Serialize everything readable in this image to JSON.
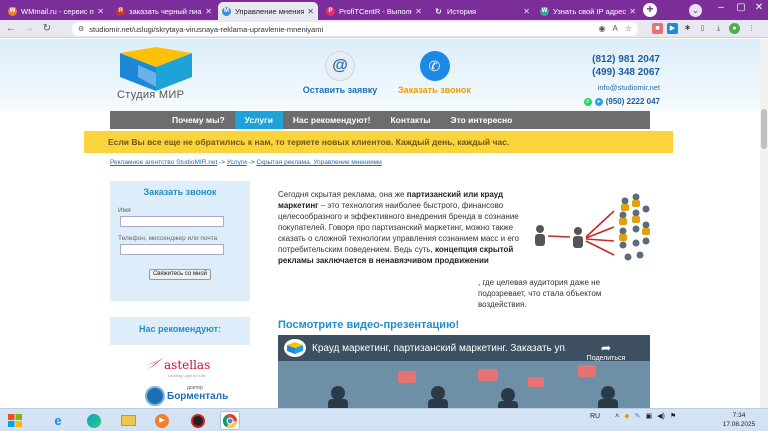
{
  "browser": {
    "tabs": [
      {
        "label": "WMmail.ru - сервис по",
        "fav_color": "#f08030",
        "fav_glyph": "W"
      },
      {
        "label": "заказать черный пиар",
        "fav_color": "#c0392b",
        "fav_glyph": "Я"
      },
      {
        "label": "Управление мнениями",
        "fav_color": "#3a8ed8",
        "fav_glyph": "М",
        "active": true
      },
      {
        "label": "ProfiTCentR - Выполн",
        "fav_color": "#e1306c",
        "fav_glyph": "P"
      },
      {
        "label": "История",
        "fav_color": "#ffffff",
        "fav_glyph": "↻"
      },
      {
        "label": "Узнать свой IP адрес",
        "fav_color": "#3aa3a0",
        "fav_glyph": "W"
      }
    ],
    "url": "studiomir.net/uslugi/skrytaya-virusnaya-reklama-upravlenie-mneniyami"
  },
  "site": {
    "logo_text": "Студия МИР",
    "header_buttons": {
      "request": "Оставить заявку",
      "call": "Заказать звонок"
    },
    "phones": [
      "(812) 981 2047",
      "(499) 348 2067"
    ],
    "email": "info@studiomir.net",
    "phone3": "(950) 2222 047",
    "menu": [
      "Почему мы?",
      "Услуги",
      "Нас рекомендуют!",
      "Контакты",
      "Это интересно"
    ],
    "menu_active": "Услуги",
    "banner": "Если Вы все еще не обратились к нам, то теряете новых клиентов. Каждый день, каждый час.",
    "breadcrumbs": {
      "home": "Рекламное агентство StudioMIR.net",
      "sep1": " -> ",
      "services": "Услуги",
      "sep2": " -> ",
      "current": "Скрытая реклама. Управление мнениями"
    },
    "callback_form": {
      "title": "Заказать звонок",
      "name_label": "Имя",
      "phone_label": "Телефон, мессенджер или почта",
      "submit": "Свяжитесь со мной"
    },
    "recommend_title": "Нас рекомендуют:",
    "astellas": {
      "name": "astellas",
      "tagline": "Leading Light for Life"
    },
    "borment": {
      "top": "доктор",
      "name": "Борменталь"
    },
    "article": {
      "p1_a": "Сегодня скрытая реклама, она же ",
      "p1_b": "партизанский или крауд маркетинг",
      "p1_c": " – это технология наиболее быстрого, финансово целесообразного и эффективного внедрения бренда в сознание покупателей. Говоря про партизанский маркетинг, можно также сказать о сложной технологии управления сознанием масс и его потребительским поведением. Ведь суть, ",
      "p1_d": "концепция скрытой рекламы заключается в ненавязчивом продвижении",
      "p1_e": ", где целевая аудитория даже не подозревает, что стала объектом воздействия."
    },
    "video_heading": "Посмотрите видео-презентацию!",
    "video_title": "Крауд маркетинг, партизанский маркетинг. Заказать уп...",
    "video_share": "Поделиться"
  },
  "taskbar": {
    "lang": "RU",
    "time": "7:34",
    "date": "17.08.2025"
  },
  "colors": {
    "chrome_frame": "#7b2e9a",
    "menu_bg": "#6d6d6d",
    "menu_active": "#1ea3d8",
    "banner": "#fbd33c",
    "accent_blue": "#1e90c8"
  }
}
